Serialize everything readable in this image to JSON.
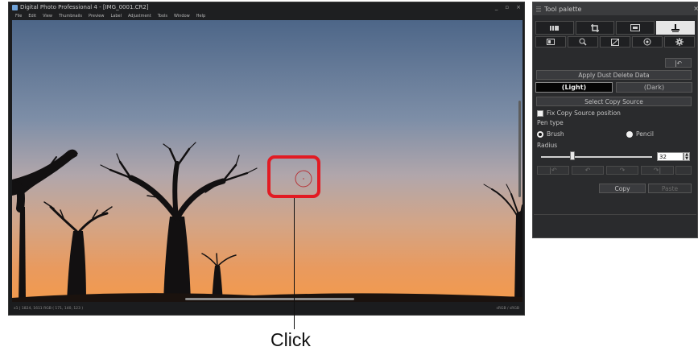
{
  "window": {
    "title": "Digital Photo Professional 4 - [IMG_0001.CR2]",
    "controls": [
      "_",
      "▫",
      "×"
    ]
  },
  "menu": [
    "File",
    "Edit",
    "View",
    "Thumbnails",
    "Preview",
    "Label",
    "Adjustment",
    "Tools",
    "Window",
    "Help"
  ],
  "status": {
    "left": "x1 | 1824, 1611 RGB ( 171, 140, 123 )",
    "right": "sRGB / sRGB"
  },
  "annotation": {
    "label": "Click"
  },
  "palette": {
    "title": "Tool palette",
    "close": "×",
    "tabs_row1": [
      "adjust-tab-icon",
      "crop-tab-icon",
      "lens-tab-icon",
      "stamp-tab-icon"
    ],
    "tabs_row2": [
      "basic-image-icon",
      "detail-icon",
      "tone-curve-icon",
      "color-icon",
      "settings-icon"
    ],
    "undo_label": "|↶",
    "apply_dust": "Apply Dust Delete Data",
    "light": "(Light)",
    "dark": "(Dark)",
    "select_source": "Select Copy Source",
    "fix_position": "Fix Copy Source position",
    "pen_type_label": "Pen type",
    "brush": "Brush",
    "pencil": "Pencil",
    "radius_label": "Radius",
    "radius_value": "32",
    "history_buttons": [
      "|↶",
      "↶",
      "↷",
      "↷|"
    ],
    "copy": "Copy",
    "paste": "Paste",
    "colors": {
      "active_tab": "#e6e6e6",
      "highlight": "#e21b23"
    }
  }
}
